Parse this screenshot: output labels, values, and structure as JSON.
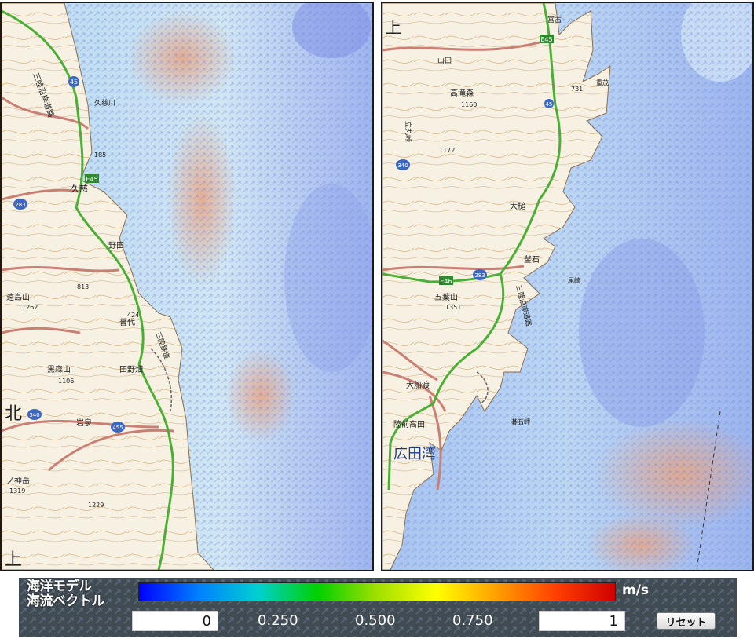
{
  "left_map": {
    "labels": {
      "rikuchu": "三陸沿岸道路",
      "kuji": "久慈",
      "noda": "野田",
      "fudai": "普代",
      "tanohata": "田野畑",
      "iwaizumi": "岩泉",
      "kita": "北",
      "kami": "上",
      "touno": "遠島山",
      "kurumori": "黒森山",
      "nakayama": "ノ神岳",
      "kuji_river": "久慈川",
      "sanriku_rail": "三陸鉄道",
      "elev_185": "185",
      "elev_813": "813",
      "elev_1262": "1262",
      "elev_1106": "1106",
      "elev_1229": "1229",
      "elev_1319": "1319",
      "elev_424": "424"
    },
    "routes": [
      "45",
      "E45",
      "340",
      "455",
      "283"
    ]
  },
  "right_map": {
    "labels": {
      "kami": "上",
      "takizawamori": "高滝森",
      "elev_1160": "1160",
      "elev_1172": "1172",
      "elev_731": "731",
      "elev_1351": "1351",
      "tachimaru": "立丸峠",
      "otsuchi": "大槌",
      "kamaishi": "釜石",
      "goyozan": "五葉山",
      "ofunato": "大船渡",
      "rikuzentakata": "陸前高田",
      "hirota": "広田湾",
      "miyako": "宮古",
      "yamada": "山田",
      "omoe": "重茂",
      "ozaki": "尾崎",
      "goishi": "碁石岬",
      "sanriku": "三陸沿岸道路"
    },
    "routes": [
      "E45",
      "45",
      "340",
      "283",
      "E46"
    ]
  },
  "legend": {
    "title_line1": "海洋モデル",
    "title_line2": "海流ベクトル",
    "unit": "m/s",
    "min_value": "0",
    "max_value": "1",
    "ticks": [
      "0.250",
      "0.500",
      "0.750"
    ],
    "reset_label": "リセット",
    "colors": [
      "#0000ff",
      "#0080ff",
      "#00d0d0",
      "#00d000",
      "#a0e000",
      "#ffff00",
      "#ffa000",
      "#ff4000",
      "#d00000"
    ]
  }
}
